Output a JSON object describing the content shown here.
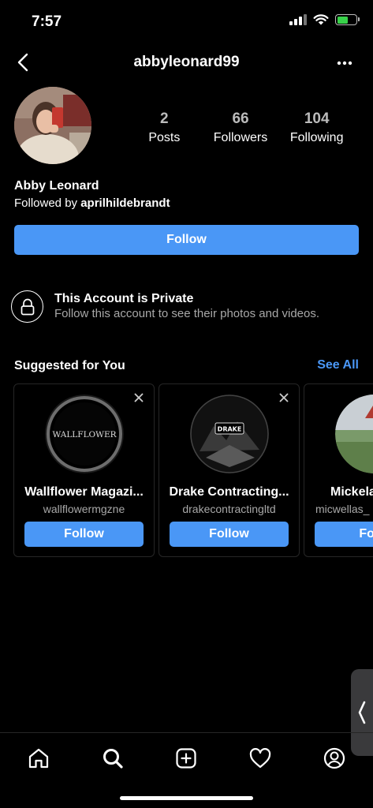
{
  "status_bar": {
    "time": "7:57"
  },
  "header": {
    "username": "abbyleonard99"
  },
  "profile": {
    "stats": [
      {
        "value": "2",
        "label": "Posts"
      },
      {
        "value": "66",
        "label": "Followers"
      },
      {
        "value": "104",
        "label": "Following"
      }
    ],
    "name": "Abby Leonard",
    "followed_by_prefix": "Followed by ",
    "followed_by_user": "aprilhildebrandt",
    "follow_label": "Follow"
  },
  "private_notice": {
    "title": "This Account is Private",
    "subtitle": "Follow this account to see their photos and videos."
  },
  "suggested": {
    "title": "Suggested for You",
    "see_all": "See All",
    "cards": [
      {
        "name": "Wallflower Magazi...",
        "handle": "wallflowermgzne",
        "avatar_text": "WALLFLOWER",
        "follow_label": "Follow"
      },
      {
        "name": "Drake Contracting...",
        "handle": "drakecontractingltd",
        "avatar_text": "DRAKE",
        "follow_label": "Follow"
      },
      {
        "name": "Mickela",
        "handle": "micwellas_",
        "avatar_text": "photo",
        "follow_label": "Follo"
      }
    ]
  },
  "tabs": [
    "home-icon",
    "search-icon",
    "add-post-icon",
    "heart-icon",
    "profile-icon"
  ],
  "colors": {
    "accent": "#4a97f6",
    "background": "#000000",
    "battery": "#38d14a"
  }
}
